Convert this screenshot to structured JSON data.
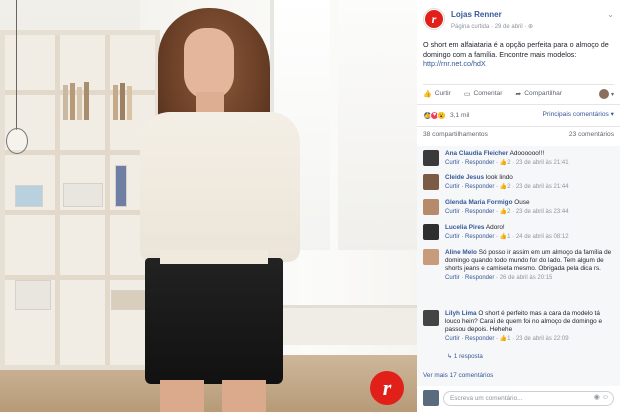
{
  "post": {
    "page_name": "Lojas Renner",
    "meta": "Página curtida · 29 de abril · ⊕",
    "text": "O short em alfaiataria é a opção perfeita para o almoço de domingo com a família. Encontre mais modelos: ",
    "link": "http://rnr.net.co/hdX",
    "logo_letter": "r"
  },
  "actions": {
    "like": "Curtir",
    "comment": "Comentar",
    "share": "Compartilhar"
  },
  "reactions": {
    "count": "3,1 mil",
    "top_comments": "Principais comentários ▾"
  },
  "stats": {
    "shares": "38 compartilhamentos",
    "comments": "23 comentários"
  },
  "comments": [
    {
      "name": "Ana Claudia Fleicher",
      "text": "Adoooooo!!!",
      "meta_reply": "Curtir · Responder · ",
      "meta_likes": "2",
      "meta_date": " · 23 de abril às 21:41"
    },
    {
      "name": "Cleide Jesus",
      "text": "look lindo",
      "meta_reply": "Curtir · Responder · ",
      "meta_likes": "2",
      "meta_date": " · 23 de abril às 21:44"
    },
    {
      "name": "Glenda Maria Formigo",
      "text": "Ouse",
      "meta_reply": "Curtir · Responder · ",
      "meta_likes": "2",
      "meta_date": " · 23 de abril às 23:44"
    },
    {
      "name": "Lucelia Pires",
      "text": "Adoro!",
      "meta_reply": "Curtir · Responder · ",
      "meta_likes": "1",
      "meta_date": " · 24 de abril às 08:12"
    },
    {
      "name": "Aline Melo",
      "text": "Só posso ir assim em um almoço da família de domingo quando todo mundo for do lado. Tem algum de shorts jeans e camiseta mesmo. Obrigada pela dica rs.",
      "meta_reply": "Curtir · Responder · ",
      "meta_likes": "",
      "meta_date": "26 de abril às 20:15"
    },
    {
      "name": "Lilyh Lima",
      "text": "O short é perfeito mas a cara da modelo tá louco hein? Caraí de quem foi no almoço de domingo e passou depois. Hehehe",
      "meta_reply": "Curtir · Responder · ",
      "meta_likes": "1",
      "meta_date": " · 23 de abril às 22:09"
    }
  ],
  "replies_label": "↳ 1 resposta",
  "more_comments": "Ver mais 17 comentários",
  "write_placeholder": "Escreva um comentário...",
  "write_tools": "◉ ☺"
}
